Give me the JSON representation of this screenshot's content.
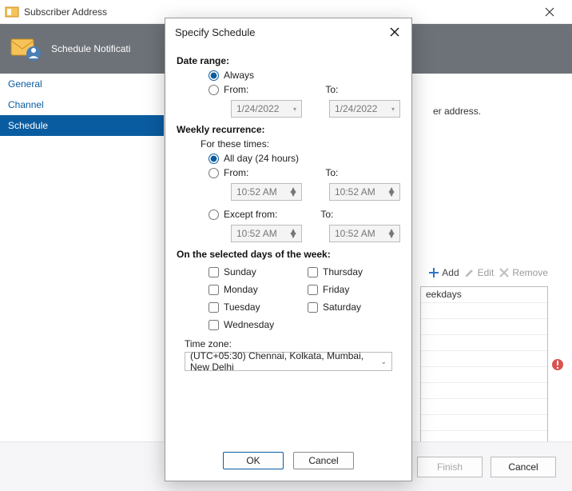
{
  "window": {
    "title": "Subscriber Address"
  },
  "banner": {
    "title": "Schedule Notificati"
  },
  "sidebar": {
    "items": [
      {
        "label": "General"
      },
      {
        "label": "Channel"
      },
      {
        "label": "Schedule"
      }
    ],
    "selected": 2
  },
  "main": {
    "hint_suffix": "er address.",
    "toolbar": {
      "add": "Add",
      "edit": "Edit",
      "remove": "Remove"
    },
    "list": {
      "row0": "eekdays"
    }
  },
  "modal": {
    "title": "Specify Schedule",
    "date_range": {
      "heading": "Date range:",
      "always": "Always",
      "from": "From:",
      "to": "To:",
      "from_value": "1/24/2022",
      "to_value": "1/24/2022"
    },
    "weekly": {
      "heading": "Weekly recurrence:",
      "sub": "For these times:",
      "allday": "All day (24 hours)",
      "from": "From:",
      "to1": "To:",
      "from_value": "10:52 AM",
      "to_value": "10:52 AM",
      "except": "Except from:",
      "to2": "To:",
      "except_from_value": "10:52 AM",
      "except_to_value": "10:52 AM"
    },
    "days": {
      "heading": "On the selected days of the week:",
      "sunday": "Sunday",
      "monday": "Monday",
      "tuesday": "Tuesday",
      "wednesday": "Wednesday",
      "thursday": "Thursday",
      "friday": "Friday",
      "saturday": "Saturday"
    },
    "tz": {
      "label": "Time zone:",
      "value": "(UTC+05:30) Chennai, Kolkata, Mumbai, New Delhi"
    },
    "buttons": {
      "ok": "OK",
      "cancel": "Cancel"
    }
  },
  "footer": {
    "finish": "Finish",
    "cancel": "Cancel"
  }
}
